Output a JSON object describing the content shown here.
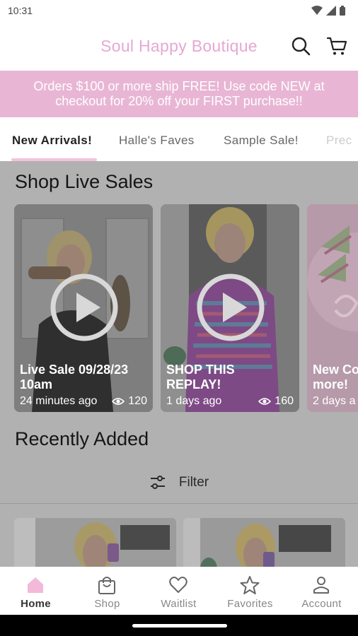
{
  "status_bar": {
    "time": "10:31"
  },
  "header": {
    "brand": "Soul Happy Boutique",
    "brand_color": "#e6a8d3"
  },
  "promo": {
    "line1": "Orders $100 or more ship FREE! Use code NEW at",
    "line2": "checkout for 20% off your FIRST purchase!!",
    "background": "#e8b6d4"
  },
  "tabs": [
    {
      "label": "New Arrivals!",
      "active": true
    },
    {
      "label": "Halle's Faves",
      "active": false
    },
    {
      "label": "Sample Sale!",
      "active": false
    },
    {
      "label": "Prec",
      "active": false
    }
  ],
  "live_sales": {
    "title": "Shop Live Sales",
    "videos": [
      {
        "caption_line1": "Live Sale 09/28/23",
        "caption_line2": "10am",
        "time_ago": "24 minutes ago",
        "views": "120",
        "icon": "play-icon"
      },
      {
        "caption_line1": "SHOP THIS",
        "caption_line2": "REPLAY!",
        "time_ago": "1 days ago",
        "views": "160",
        "icon": "play-icon"
      },
      {
        "caption_line1": "New Co",
        "caption_line2": "more!",
        "time_ago": "2 days a",
        "views": "",
        "icon": ""
      }
    ]
  },
  "recently_added": {
    "title": "Recently Added",
    "filter_label": "Filter"
  },
  "bottom_nav": [
    {
      "label": "Home",
      "icon": "home-icon",
      "active": true
    },
    {
      "label": "Shop",
      "icon": "shopping-bag-icon",
      "active": false
    },
    {
      "label": "Waitlist",
      "icon": "heart-icon",
      "active": false
    },
    {
      "label": "Favorites",
      "icon": "star-icon",
      "active": false
    },
    {
      "label": "Account",
      "icon": "person-icon",
      "active": false
    }
  ]
}
